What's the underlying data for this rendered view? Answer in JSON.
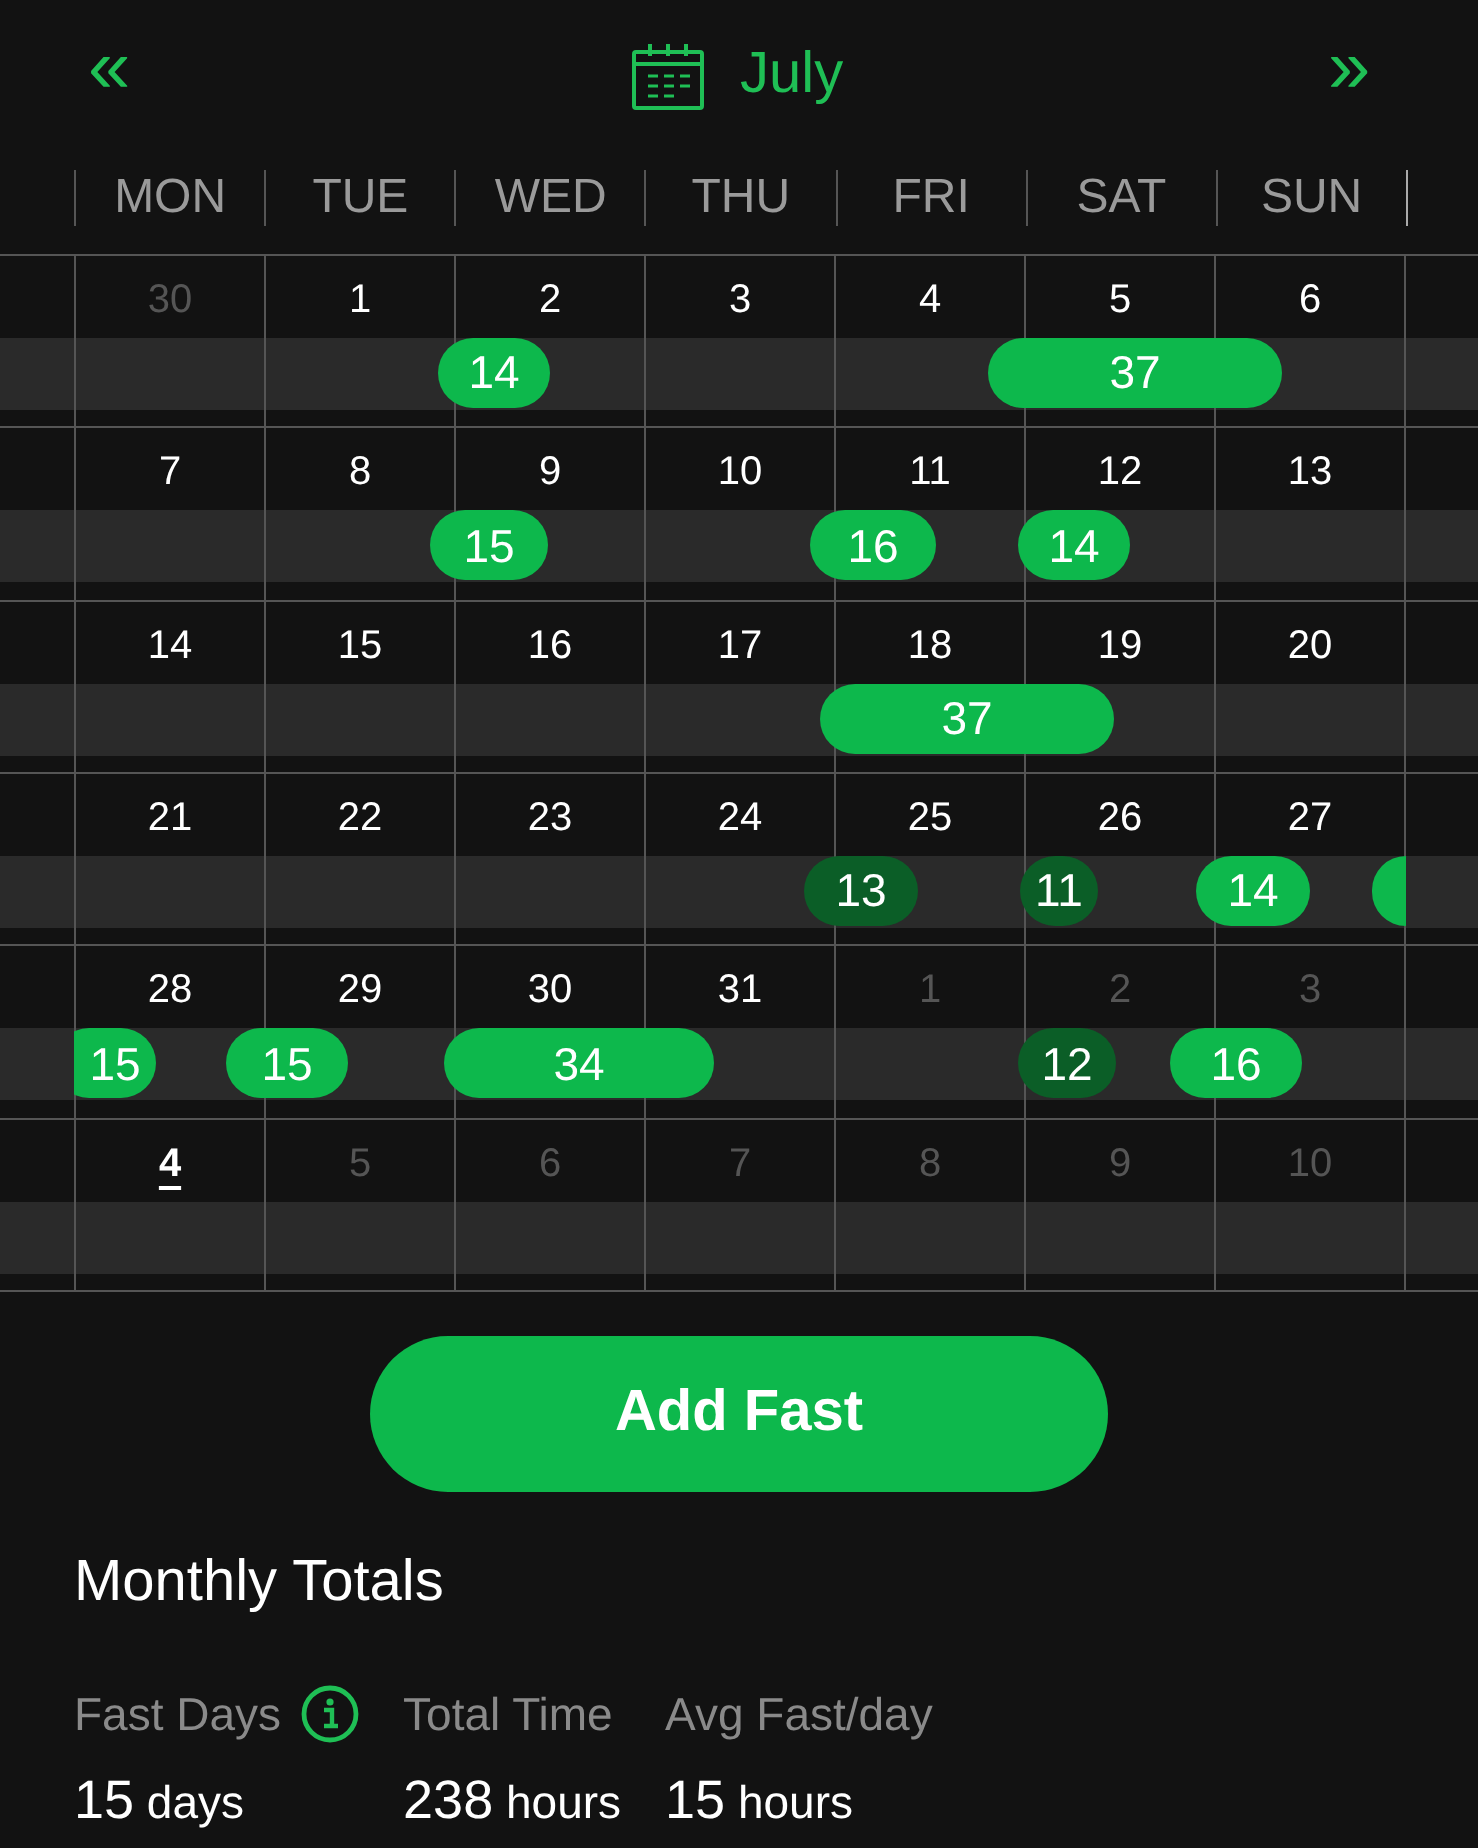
{
  "header": {
    "prev": "«",
    "month": "July",
    "next": "»"
  },
  "weekdays": [
    "MON",
    "TUE",
    "WED",
    "THU",
    "FRI",
    "SAT",
    "SUN"
  ],
  "weeks": [
    {
      "days": [
        {
          "label": "30",
          "muted": true,
          "today": false
        },
        {
          "label": "1",
          "muted": false,
          "today": false
        },
        {
          "label": "2",
          "muted": false,
          "today": false
        },
        {
          "label": "3",
          "muted": false,
          "today": false
        },
        {
          "label": "4",
          "muted": false,
          "today": false
        },
        {
          "label": "5",
          "muted": false,
          "today": false
        },
        {
          "label": "6",
          "muted": false,
          "today": false
        }
      ],
      "fasts": [
        {
          "label": "14",
          "color": "#0db84c",
          "continued": false
        },
        {
          "label": "37",
          "color": "#0db84c",
          "continued": false
        }
      ]
    },
    {
      "days": [
        {
          "label": "7",
          "muted": false,
          "today": false
        },
        {
          "label": "8",
          "muted": false,
          "today": false
        },
        {
          "label": "9",
          "muted": false,
          "today": false
        },
        {
          "label": "10",
          "muted": false,
          "today": false
        },
        {
          "label": "11",
          "muted": false,
          "today": false
        },
        {
          "label": "12",
          "muted": false,
          "today": false
        },
        {
          "label": "13",
          "muted": false,
          "today": false
        }
      ],
      "fasts": [
        {
          "label": "15",
          "color": "#0db84c",
          "continued": false
        },
        {
          "label": "16",
          "color": "#0db84c",
          "continued": false
        },
        {
          "label": "14",
          "color": "#0db84c",
          "continued": false
        }
      ]
    },
    {
      "days": [
        {
          "label": "14",
          "muted": false,
          "today": false
        },
        {
          "label": "15",
          "muted": false,
          "today": false
        },
        {
          "label": "16",
          "muted": false,
          "today": false
        },
        {
          "label": "17",
          "muted": false,
          "today": false
        },
        {
          "label": "18",
          "muted": false,
          "today": false
        },
        {
          "label": "19",
          "muted": false,
          "today": false
        },
        {
          "label": "20",
          "muted": false,
          "today": false
        }
      ],
      "fasts": [
        {
          "label": "37",
          "color": "#0db84c",
          "continued": false
        }
      ]
    },
    {
      "days": [
        {
          "label": "21",
          "muted": false,
          "today": false
        },
        {
          "label": "22",
          "muted": false,
          "today": false
        },
        {
          "label": "23",
          "muted": false,
          "today": false
        },
        {
          "label": "24",
          "muted": false,
          "today": false
        },
        {
          "label": "25",
          "muted": false,
          "today": false
        },
        {
          "label": "26",
          "muted": false,
          "today": false
        },
        {
          "label": "27",
          "muted": false,
          "today": false
        }
      ],
      "fasts": [
        {
          "label": "13",
          "color": "#0b5e27",
          "continued": false
        },
        {
          "label": "11",
          "color": "#0b5e27",
          "continued": false
        },
        {
          "label": "14",
          "color": "#0db84c",
          "continued": false
        }
      ]
    },
    {
      "days": [
        {
          "label": "28",
          "muted": false,
          "today": false
        },
        {
          "label": "29",
          "muted": false,
          "today": false
        },
        {
          "label": "30",
          "muted": false,
          "today": false
        },
        {
          "label": "31",
          "muted": false,
          "today": false
        },
        {
          "label": "1",
          "muted": true,
          "today": false
        },
        {
          "label": "2",
          "muted": true,
          "today": false
        },
        {
          "label": "3",
          "muted": true,
          "today": false
        }
      ],
      "fasts": [
        {
          "label": "15",
          "color": "#0db84c",
          "continued": true
        },
        {
          "label": "15",
          "color": "#0db84c",
          "continued": false
        },
        {
          "label": "34",
          "color": "#0db84c",
          "continued": false
        },
        {
          "label": "12",
          "color": "#0b5e27",
          "continued": false
        },
        {
          "label": "16",
          "color": "#0db84c",
          "continued": false
        }
      ]
    },
    {
      "days": [
        {
          "label": "4",
          "muted": false,
          "today": true
        },
        {
          "label": "5",
          "muted": true,
          "today": false
        },
        {
          "label": "6",
          "muted": true,
          "today": false
        },
        {
          "label": "7",
          "muted": true,
          "today": false
        },
        {
          "label": "8",
          "muted": true,
          "today": false
        },
        {
          "label": "9",
          "muted": true,
          "today": false
        },
        {
          "label": "10",
          "muted": true,
          "today": false
        }
      ]
    }
  ],
  "add_button": "Add Fast",
  "totals": {
    "title": "Monthly Totals",
    "stats": [
      {
        "label": "Fast Days",
        "info": true,
        "value": "15",
        "unit": "days"
      },
      {
        "label": "Total Time",
        "info": false,
        "value": "238",
        "unit": "hours"
      },
      {
        "label": "Avg Fast/day",
        "info": false,
        "value": "15",
        "unit": "hours"
      }
    ]
  }
}
